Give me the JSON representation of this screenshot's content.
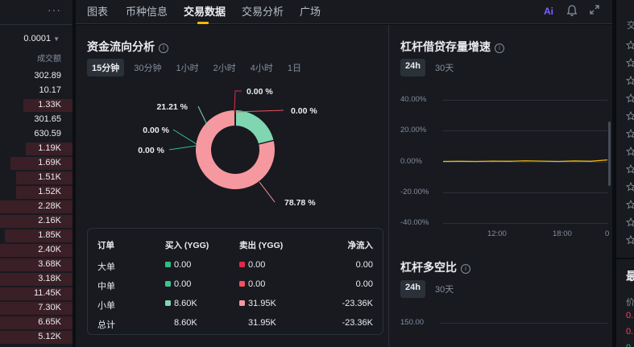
{
  "orderbook": {
    "more_label": "···",
    "precision": "0.0001",
    "column_header": "成交额",
    "rows": [
      {
        "value": "302.89",
        "depth": 0.0
      },
      {
        "value": "10.17",
        "depth": 0.0
      },
      {
        "value": "1.33K",
        "depth": 0.68
      },
      {
        "value": "301.65",
        "depth": 0.0
      },
      {
        "value": "630.59",
        "depth": 0.0
      },
      {
        "value": "1.19K",
        "depth": 0.65
      },
      {
        "value": "1.69K",
        "depth": 0.86
      },
      {
        "value": "1.51K",
        "depth": 0.78
      },
      {
        "value": "1.52K",
        "depth": 0.78
      },
      {
        "value": "2.28K",
        "depth": 1.0
      },
      {
        "value": "2.16K",
        "depth": 1.0
      },
      {
        "value": "1.85K",
        "depth": 0.93
      },
      {
        "value": "2.40K",
        "depth": 1.0
      },
      {
        "value": "3.68K",
        "depth": 1.0
      },
      {
        "value": "3.18K",
        "depth": 1.0
      },
      {
        "value": "11.45K",
        "depth": 1.0
      },
      {
        "value": "7.30K",
        "depth": 1.0
      },
      {
        "value": "6.65K",
        "depth": 1.0
      },
      {
        "value": "5.12K",
        "depth": 1.0
      }
    ]
  },
  "tabs": [
    {
      "label": "图表"
    },
    {
      "label": "币种信息"
    },
    {
      "label": "交易数据",
      "active": true
    },
    {
      "label": "交易分析"
    },
    {
      "label": "广场"
    }
  ],
  "toolbar": {
    "ai_label": "Ai"
  },
  "flow": {
    "title": "资金流向分析",
    "periods": [
      "15分钟",
      "30分钟",
      "1小时",
      "2小时",
      "4小时",
      "1日"
    ],
    "active_period": 0,
    "donut_labels": [
      "0.00 %",
      "0.00 %",
      "21.21 %",
      "0.00 %",
      "0.00 %",
      "78.78 %"
    ],
    "chart_data": {
      "type": "pie",
      "slices": [
        {
          "label": "大单买入",
          "percent": 0.0,
          "color": "#2ebd85"
        },
        {
          "label": "中单买入",
          "percent": 0.0,
          "color": "#3dc48f"
        },
        {
          "label": "小单买入",
          "percent": 21.21,
          "color": "#7fd6b0"
        },
        {
          "label": "小单卖出",
          "percent": 78.78,
          "color": "#f6989f"
        },
        {
          "label": "中单卖出",
          "percent": 0.0,
          "color": "#f0515e"
        },
        {
          "label": "大单卖出",
          "percent": 0.0,
          "color": "#e0294a"
        }
      ]
    },
    "table": {
      "headers": [
        "订单",
        "买入 (YGG)",
        "卖出 (YGG)",
        "净流入"
      ],
      "rows": [
        {
          "label": "大单",
          "buy": "0.00",
          "sell": "0.00",
          "net": "0.00",
          "buy_color": "#2ebd85",
          "sell_color": "#e0294a"
        },
        {
          "label": "中单",
          "buy": "0.00",
          "sell": "0.00",
          "net": "0.00",
          "buy_color": "#3dc48f",
          "sell_color": "#f0515e"
        },
        {
          "label": "小单",
          "buy": "8.60K",
          "sell": "31.95K",
          "net": "-23.36K",
          "buy_color": "#7fd6b0",
          "sell_color": "#f6989f"
        },
        {
          "label": "总计",
          "buy": "8.60K",
          "sell": "31.95K",
          "net": "-23.36K"
        }
      ]
    }
  },
  "margin_growth": {
    "title": "杠杆借贷存量增速",
    "periods": [
      "24h",
      "30天"
    ],
    "active_period": 0,
    "chart_data": {
      "type": "line",
      "y_ticks": [
        "40.00%",
        "20.00%",
        "0.00%",
        "-20.00%",
        "-40.00%"
      ],
      "ylim": [
        -40,
        40
      ],
      "x_ticks": [
        "12:00",
        "18:00",
        "0"
      ],
      "series": [
        {
          "color": "#f0b90b",
          "x": [
            0,
            10,
            20,
            30,
            40,
            50,
            60,
            70,
            80,
            90,
            100
          ],
          "values": [
            0.0,
            0.1,
            0.0,
            0.2,
            0.1,
            0.4,
            0.2,
            0.0,
            0.3,
            0.1,
            1.0
          ]
        }
      ]
    }
  },
  "long_short": {
    "title": "杠杆多空比",
    "periods": [
      "24h",
      "30天"
    ],
    "active_period": 0,
    "y_tick": "150.00"
  },
  "far_panel": {
    "header": "交",
    "bottom_title": "最",
    "bottom_sub": "价",
    "prices": [
      "0.",
      "0.",
      "0."
    ],
    "price_colors": [
      "#f6465d",
      "#f6465d",
      "#2ebd85"
    ]
  }
}
